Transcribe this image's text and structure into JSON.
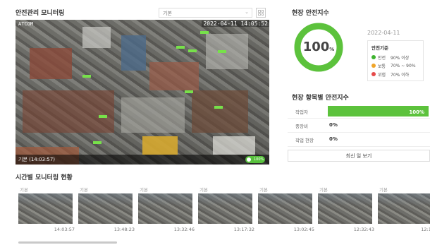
{
  "monitor": {
    "title": "안전관리 모니터링",
    "select_value": "기본",
    "camera_label": "ATCOM",
    "timestamp": "2022-04-11 14:05:52",
    "footer_label": "기본 (14:03:57)",
    "status_pill": "100%"
  },
  "safety_index": {
    "title": "현장 안전지수",
    "score": 100,
    "score_label": "100",
    "unit": "%",
    "date": "2022-04-11",
    "legend_title": "안전기준",
    "legend": [
      {
        "name": "안전",
        "range": "90% 이상",
        "color": "#3db32e"
      },
      {
        "name": "보통",
        "range": "70% ~ 90%",
        "color": "#f0a52a"
      },
      {
        "name": "위험",
        "range": "70% 이하",
        "color": "#e64a4a"
      }
    ]
  },
  "item_index": {
    "title": "현장 항목별 안전지수",
    "items": [
      {
        "label": "작업자",
        "value": "100%",
        "fraction": 1.0
      },
      {
        "label": "중장비",
        "value": "0%",
        "fraction": 0
      },
      {
        "label": "작업 현장",
        "value": "0%",
        "fraction": 0
      }
    ],
    "recent_button": "최신 일 보기",
    "bar_color": "#5cc23c"
  },
  "timeline": {
    "title": "시간별 모니터링 현황",
    "thumbnails": [
      {
        "label": "기본",
        "time": "14:03:57"
      },
      {
        "label": "기본",
        "time": "13:48:23"
      },
      {
        "label": "기본",
        "time": "13:32:46"
      },
      {
        "label": "기본",
        "time": "13:17:32"
      },
      {
        "label": "기본",
        "time": "13:02:45"
      },
      {
        "label": "기본",
        "time": "12:32:43"
      },
      {
        "label": "기본",
        "time": "12:17"
      }
    ]
  }
}
